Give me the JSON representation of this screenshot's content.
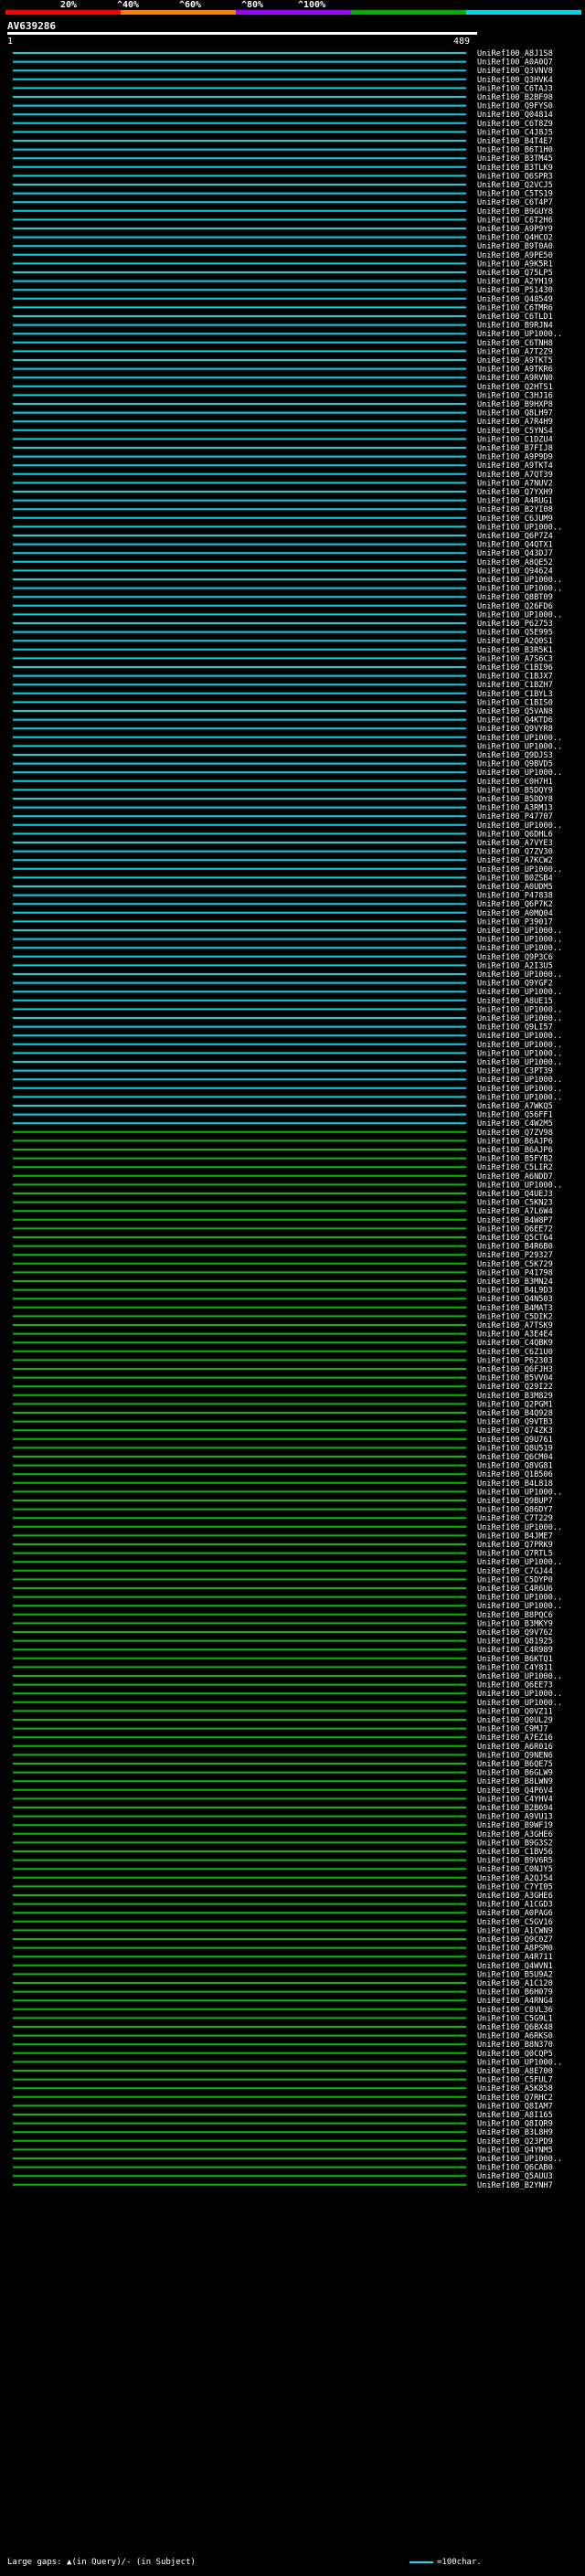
{
  "legend": {
    "labels": [
      "20%",
      "^40%",
      "^60%",
      "^80%",
      "^100%"
    ],
    "colors": [
      "#ff0000",
      "#ff8000",
      "#a000ff",
      "#00b000",
      "#00d8e8"
    ]
  },
  "query": {
    "name": "AV639286",
    "start_label": "1",
    "end_label": "489"
  },
  "footer": {
    "gaps_text": "Large gaps: ▲(in Query)/- (in Subject)",
    "scale_text": "=100char."
  },
  "chart_data": {
    "type": "alignment",
    "x_range": [
      1,
      489
    ],
    "colors": {
      "cyan": "#00d8e8",
      "green": "#00c000"
    },
    "hits": [
      "UniRef100_A8J1S8",
      "UniRef100_A0A0Q7",
      "UniRef100_Q3VNV8",
      "UniRef100_Q3HVK4",
      "UniRef100_C6TAJ3",
      "UniRef100_B2BF98",
      "UniRef100_Q9FYS0",
      "UniRef100_Q04814",
      "UniRef100_C6T8Z9",
      "UniRef100_C4J8J5",
      "UniRef100_B4T4E7",
      "UniRef100_B6T1H0",
      "UniRef100_B3TM45",
      "UniRef100_B3TLK9",
      "UniRef100_Q6SPR3",
      "UniRef100_Q2VCJ5",
      "UniRef100_C5TS19",
      "UniRef100_C6T4P7",
      "UniRef100_B9GUY8",
      "UniRef100_C6T2H6",
      "UniRef100_A9P9Y9",
      "UniRef100_Q4HCO2",
      "UniRef100_B9T0A0",
      "UniRef100_A9PE50",
      "UniRef100_A9K5R1",
      "UniRef100_Q75LP5",
      "UniRef100_A2YH19",
      "UniRef100_P51430",
      "UniRef100_Q48549",
      "UniRef100_C6TMR6",
      "UniRef100_C6TLD1",
      "UniRef100_B9RJN4",
      "UniRef100_UP1000..",
      "UniRef100_C6TNH8",
      "UniRef100_A7T2Z9",
      "UniRef100_A9TKT5",
      "UniRef100_A9TKR6",
      "UniRef100_A9RVN0",
      "UniRef100_Q2HTS1",
      "UniRef100_C3HJ16",
      "UniRef100_B9HXP8",
      "UniRef100_Q8LH97",
      "UniRef100_A7R4H9",
      "UniRef100_C5YNS4",
      "UniRef100_C1DZU4",
      "UniRef100_B7FIJ8",
      "UniRef100_A9P9D9",
      "UniRef100_A9TKT4",
      "UniRef100_A7QT39",
      "UniRef100_A7NUV2",
      "UniRef100_Q7YXH9",
      "UniRef100_A4RUG1",
      "UniRef100_B2YI08",
      "UniRef100_C6JUM9",
      "UniRef100_UP1000..",
      "UniRef100_Q6P7Z4",
      "UniRef100_Q4QTX1",
      "UniRef100_Q43DJ7",
      "UniRef100_A8QE52",
      "UniRef100_Q94624",
      "UniRef100_UP1000..",
      "UniRef100_UP1000..",
      "UniRef100_Q8BT09",
      "UniRef100_Q26FD6",
      "UniRef100_UP1000..",
      "UniRef100_P62753",
      "UniRef100_Q5E995",
      "UniRef100_A2Q0S1",
      "UniRef100_B3R5K1",
      "UniRef100_A7S6C3",
      "UniRef100_C1BI96",
      "UniRef100_C1BJX7",
      "UniRef100_C1BZH7",
      "UniRef100_C1BYL3",
      "UniRef100_C1BIS0",
      "UniRef100_Q5VAN8",
      "UniRef100_Q4KTD6",
      "UniRef100_Q9VYR8",
      "UniRef100_UP1000..",
      "UniRef100_UP1000..",
      "UniRef100_Q9DJS3",
      "UniRef100_Q9BVD5",
      "UniRef100_UP1000..",
      "UniRef100_C0H7H1",
      "UniRef100_B5DQY9",
      "UniRef100_B5DDY8",
      "UniRef100_A3RM13",
      "UniRef100_P47707",
      "UniRef100_UP1000..",
      "UniRef100_Q6DHL6",
      "UniRef100_A7VYE3",
      "UniRef100_Q7ZV30",
      "UniRef100_A7KCW2",
      "UniRef100_UP1000..",
      "UniRef100_B0ZSB4",
      "UniRef100_A0UDM5",
      "UniRef100_P47838",
      "UniRef100_Q6P7K2",
      "UniRef100_A0MQ04",
      "UniRef100_P39017",
      "UniRef100_UP1000..",
      "UniRef100_UP1000..",
      "UniRef100_UP1000..",
      "UniRef100_Q9P3C6",
      "UniRef100_A2I3U5",
      "UniRef100_UP1000..",
      "UniRef100_Q9YGF2",
      "UniRef100_UP1000..",
      "UniRef100_A8UE15",
      "UniRef100_UP1000..",
      "UniRef100_UP1000..",
      "UniRef100_Q9LI57",
      "UniRef100_UP1000..",
      "UniRef100_UP1000..",
      "UniRef100_UP1000..",
      "UniRef100_UP1000..",
      "UniRef100_C3PT39",
      "UniRef100_UP1000..",
      "UniRef100_UP1000..",
      "UniRef100_UP1000..",
      "UniRef100_A7WKQ5",
      "UniRef100_Q56FF1",
      "UniRef100_C4W2M5",
      "UniRef100_Q7ZV98",
      "UniRef100_B6AJP6",
      "UniRef100_B6AJP6",
      "UniRef100_B5FYB2",
      "UniRef100_C5LIR2",
      "UniRef100_A6NDD7",
      "UniRef100_UP1000..",
      "UniRef100_Q4UEJ3",
      "UniRef100_C5KN23",
      "UniRef100_A7L6W4",
      "UniRef100_B4W8P7",
      "UniRef100_Q6EE72",
      "UniRef100_Q5CT64",
      "UniRef100_B4R6B0",
      "UniRef100_P29327",
      "UniRef100_C5K729",
      "UniRef100_P41798",
      "UniRef100_B3MN24",
      "UniRef100_B4L9D3",
      "UniRef100_Q4N503",
      "UniRef100_B4MAT3",
      "UniRef100_C5DIK2",
      "UniRef100_A7TSK9",
      "UniRef100_A3E4E4",
      "UniRef100_C4QBK9",
      "UniRef100_C6Z1U0",
      "UniRef100_P62303",
      "UniRef100_Q6FJH3",
      "UniRef100_B5VV04",
      "UniRef100_Q29I22",
      "UniRef100_B3M829",
      "UniRef100_Q2PGM1",
      "UniRef100_B4Q928",
      "UniRef100_Q9VTB3",
      "UniRef100_Q74ZK3",
      "UniRef100_Q9U761",
      "UniRef100_Q8U519",
      "UniRef100_Q6CM04",
      "UniRef100_Q8VG81",
      "UniRef100_Q1B506",
      "UniRef100_B4L818",
      "UniRef100_UP1000..",
      "UniRef100_Q9BUP7",
      "UniRef100_Q86DY7",
      "UniRef100_C7T229",
      "UniRef100_UP1000..",
      "UniRef100_B4JME7",
      "UniRef100_Q7PRK9",
      "UniRef100_Q7RTL5",
      "UniRef100_UP1000..",
      "UniRef100_C7GJ44",
      "UniRef100_C5DYP0",
      "UniRef100_C4R6U6",
      "UniRef100_UP1000..",
      "UniRef100_UP1000..",
      "UniRef100_B8PQC6",
      "UniRef100_B3MKY9",
      "UniRef100_Q9V762",
      "UniRef100_Q81925",
      "UniRef100_C4R989",
      "UniRef100_B6KTQ1",
      "UniRef100_C4Y811",
      "UniRef100_UP1000..",
      "UniRef100_Q6EE73",
      "UniRef100_UP1000..",
      "UniRef100_UP1000..",
      "UniRef100_Q0VZ11",
      "UniRef100_Q0UL29",
      "UniRef100_C9MJ7",
      "UniRef100_A7EZ16",
      "UniRef100_A6R016",
      "UniRef100_Q9NEN6",
      "UniRef100_B6QE75",
      "UniRef100_B6GLW9",
      "UniRef100_B8LWN9",
      "UniRef100_Q4P6V4",
      "UniRef100_C4YHV4",
      "UniRef100_B2B694",
      "UniRef100_A9VU13",
      "UniRef100_B9WF19",
      "UniRef100_A3GHE6",
      "UniRef100_B9G3S2",
      "UniRef100_C1BV56",
      "UniRef100_B9V6R5",
      "UniRef100_C0NJY5",
      "UniRef100_A2QJ54",
      "UniRef100_C7YI05",
      "UniRef100_A3GHE6",
      "UniRef100_A1CGD3",
      "UniRef100_A0PAG6",
      "UniRef100_C5GV16",
      "UniRef100_A1CWN9",
      "UniRef100_Q9C0Z7",
      "UniRef100_A8PSM0",
      "UniRef100_A4R711",
      "UniRef100_Q4WVN1",
      "UniRef100_B5U9A2",
      "UniRef100_A1C120",
      "UniRef100_B6H079",
      "UniRef100_A4RNG4",
      "UniRef100_C8VL36",
      "UniRef100_C5G9L1",
      "UniRef100_Q6BX48",
      "UniRef100_A6RKS0",
      "UniRef100_B8N370",
      "UniRef100_Q0CQP5",
      "UniRef100_UP1000..",
      "UniRef100_A8E700",
      "UniRef100_C5FUL7",
      "UniRef100_A5K858",
      "UniRef100_Q7RHC2",
      "UniRef100_Q8IAM7",
      "UniRef100_A8I165",
      "UniRef100_Q8IQR9",
      "UniRef100_B3L8H9",
      "UniRef100_Q23PD9",
      "UniRef100_Q4YNM5",
      "UniRef100_UP1000..",
      "UniRef100_Q6CAB0",
      "UniRef100_Q5AUU3",
      "UniRef100_B2YNH7"
    ]
  }
}
